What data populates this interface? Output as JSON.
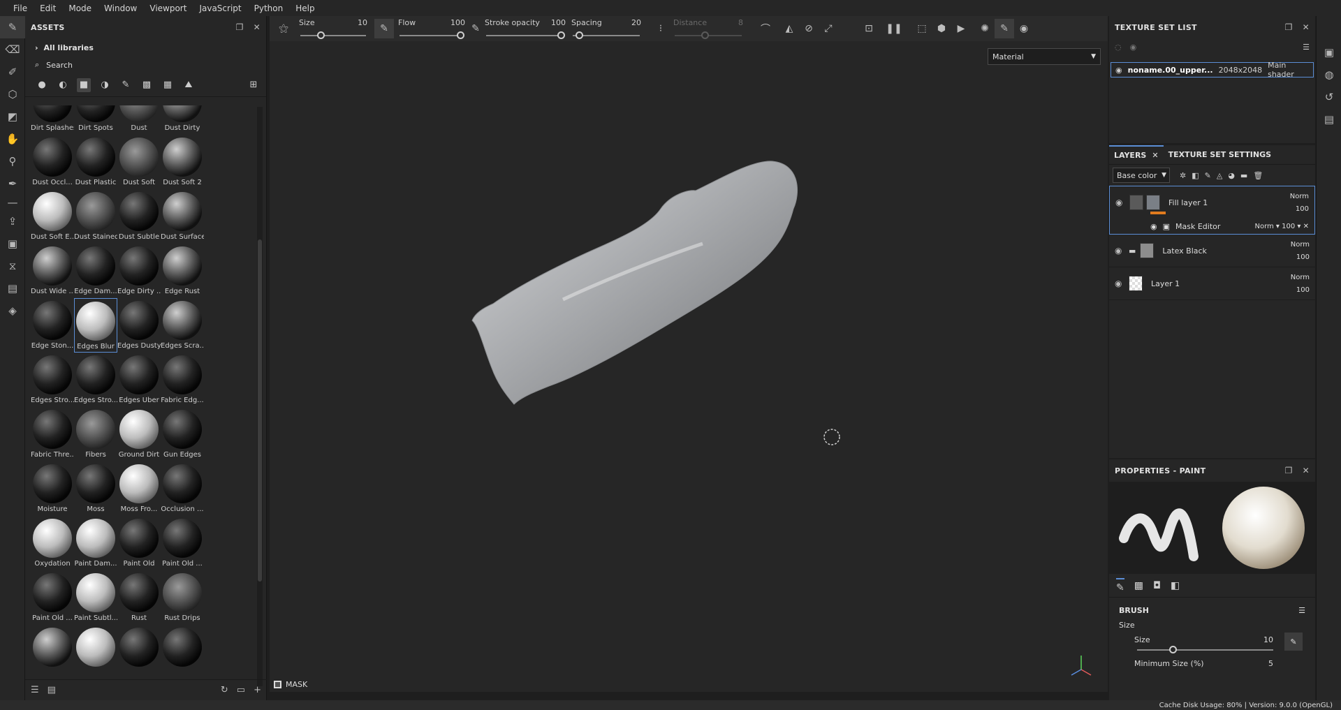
{
  "menu": [
    "File",
    "Edit",
    "Mode",
    "Window",
    "Viewport",
    "JavaScript",
    "Python",
    "Help"
  ],
  "assets": {
    "title": "ASSETS",
    "libraries": "All libraries",
    "search_placeholder": "Search",
    "items": [
      "Dirt Splashes",
      "Dirt Spots",
      "Dust",
      "Dust Dirty",
      "Dust Occl...",
      "Dust Plastic",
      "Dust Soft",
      "Dust Soft 2",
      "Dust Soft E...",
      "Dust Stained",
      "Dust Subtle",
      "Dust Surface",
      "Dust Wide ...",
      "Edge Dam...",
      "Edge Dirty ...",
      "Edge Rust",
      "Edge Ston...",
      "Edges Blur",
      "Edges Dusty",
      "Edges Scra...",
      "Edges Stro...",
      "Edges Stro...",
      "Edges Uber",
      "Fabric Edg...",
      "Fabric Thre...",
      "Fibers",
      "Ground Dirt",
      "Gun Edges",
      "Moisture",
      "Moss",
      "Moss Fro...",
      "Occlusion ...",
      "Oxydation",
      "Paint Dam...",
      "Paint Old",
      "Paint Old ...",
      "Paint Old ...",
      "Paint Subtl...",
      "Rust",
      "Rust Drips",
      "",
      "",
      "",
      ""
    ],
    "selected": "Edges Blur"
  },
  "toolbar": {
    "size_label": "Size",
    "size_value": "10",
    "flow_label": "Flow",
    "flow_value": "100",
    "opacity_label": "Stroke opacity",
    "opacity_value": "100",
    "spacing_label": "Spacing",
    "spacing_value": "20",
    "distance_label": "Distance",
    "distance_value": "8"
  },
  "viewport": {
    "material_select": "Material",
    "mask_label": "MASK"
  },
  "texture_set": {
    "title": "TEXTURE SET LIST",
    "name": "noname.00_upper...",
    "resolution": "2048x2048",
    "shader": "Main shader"
  },
  "layers": {
    "tab_layers": "LAYERS",
    "tab_settings": "TEXTURE SET SETTINGS",
    "channel": "Base color",
    "fill_layer": {
      "name": "Fill layer 1",
      "blend": "Norm",
      "opacity": "100"
    },
    "mask_editor": {
      "name": "Mask Editor",
      "blend": "Norm",
      "opacity": "100"
    },
    "latex": {
      "name": "Latex Black",
      "blend": "Norm",
      "opacity": "100"
    },
    "layer1": {
      "name": "Layer 1",
      "blend": "Norm",
      "opacity": "100"
    }
  },
  "properties": {
    "title": "PROPERTIES - PAINT",
    "brush_section": "BRUSH",
    "size_group": "Size",
    "size_label": "Size",
    "size_value": "10",
    "min_size_label": "Minimum Size (%)",
    "min_size_value": "5"
  },
  "status": {
    "text": "Cache Disk Usage:   80% | Version: 9.0.0 (OpenGL)"
  }
}
